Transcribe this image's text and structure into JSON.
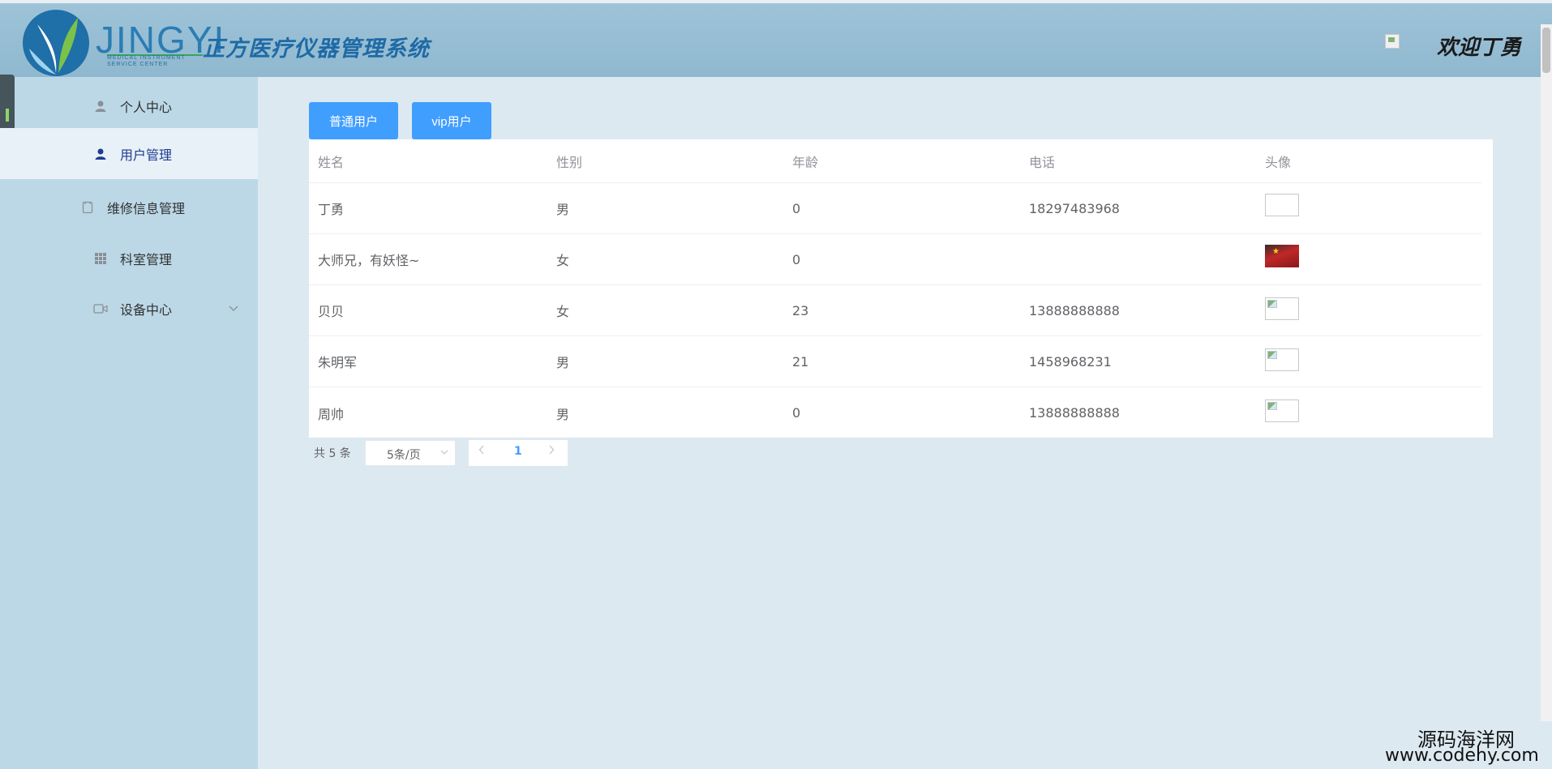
{
  "header": {
    "logo_text": "JINGYI",
    "logo_sub": "MEDICAL INSTRUMENT SERVICE CENTER",
    "system_title": "正方医疗仪器管理系统",
    "welcome": "欢迎丁勇",
    "logo_color": "#2a7db3"
  },
  "sidebar": {
    "items": [
      {
        "label": "个人中心",
        "icon": "user-outline-icon",
        "active": false
      },
      {
        "label": "用户管理",
        "icon": "user-solid-icon",
        "active": true
      },
      {
        "label": "维修信息管理",
        "icon": "document-icon",
        "active": false
      },
      {
        "label": "科室管理",
        "icon": "grid-icon",
        "active": false
      },
      {
        "label": "设备中心",
        "icon": "video-camera-icon",
        "active": false,
        "has_submenu": true
      }
    ]
  },
  "tabs": [
    {
      "label": "普通用户"
    },
    {
      "label": "vip用户"
    }
  ],
  "table": {
    "columns": [
      "姓名",
      "性别",
      "年龄",
      "电话",
      "头像"
    ],
    "rows": [
      {
        "name": "丁勇",
        "gender": "男",
        "age": "0",
        "phone": "18297483968",
        "avatar": "blank"
      },
      {
        "name": "大师兄，有妖怪~",
        "gender": "女",
        "age": "0",
        "phone": "",
        "avatar": "flag"
      },
      {
        "name": "贝贝",
        "gender": "女",
        "age": "23",
        "phone": "13888888888",
        "avatar": "broken"
      },
      {
        "name": "朱明军",
        "gender": "男",
        "age": "21",
        "phone": "1458968231",
        "avatar": "broken"
      },
      {
        "name": "周帅",
        "gender": "男",
        "age": "0",
        "phone": "13888888888",
        "avatar": "broken"
      }
    ]
  },
  "pagination": {
    "total_text": "共 5 条",
    "page_size": "5条/页",
    "current_page": "1"
  },
  "watermark": {
    "line1": "源码海洋网",
    "line2": "www.codehy.com"
  },
  "colors": {
    "primary": "#409eff",
    "sidebar_bg": "#bcd8e6",
    "header_bg": "#9ec3d8",
    "active_text": "#1f3b8f"
  }
}
